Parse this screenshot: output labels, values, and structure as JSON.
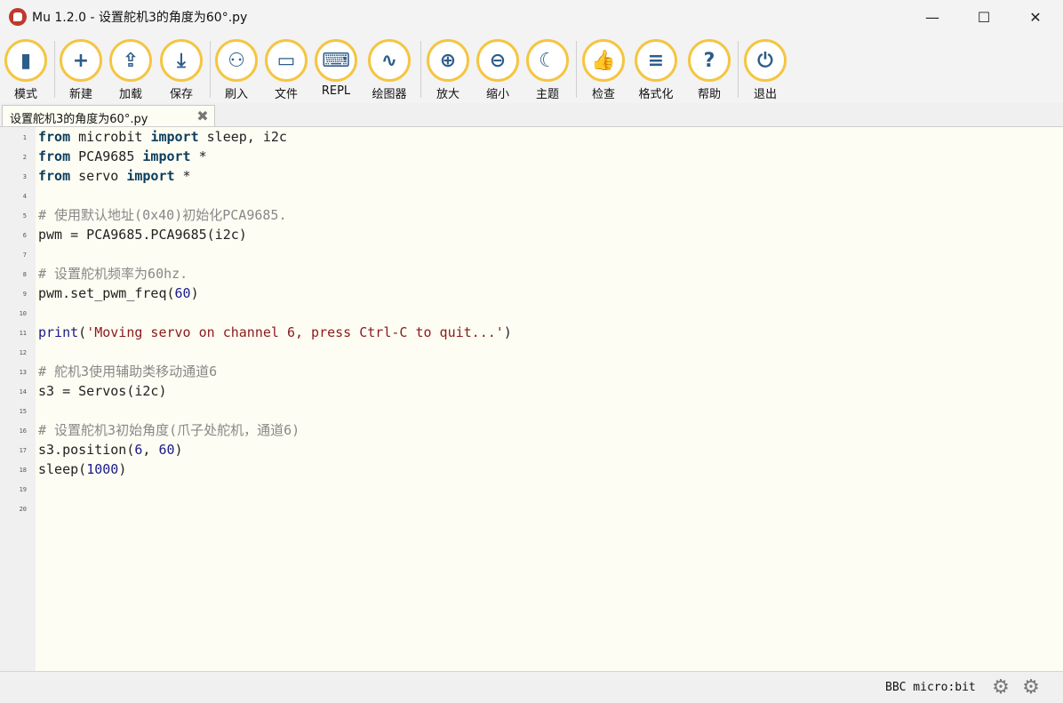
{
  "window": {
    "title": "Mu 1.2.0 - 设置舵机3的角度为60°.py",
    "minimize": "—",
    "maximize": "☐",
    "close": "✕"
  },
  "toolbar": {
    "buttons": [
      {
        "label": "模式",
        "icon": "mode-icon",
        "glyph": "▮"
      },
      {
        "label": "新建",
        "icon": "plus-icon",
        "glyph": "+"
      },
      {
        "label": "加载",
        "icon": "upload-icon",
        "glyph": "⇪"
      },
      {
        "label": "保存",
        "icon": "download-icon",
        "glyph": "⤓"
      },
      {
        "label": "刷入",
        "icon": "microbit-icon",
        "glyph": "⚇"
      },
      {
        "label": "文件",
        "icon": "files-icon",
        "glyph": "▭"
      },
      {
        "label": "REPL",
        "icon": "keyboard-icon",
        "glyph": "⌨"
      },
      {
        "label": "绘图器",
        "icon": "plotter-icon",
        "glyph": "∿"
      },
      {
        "label": "放大",
        "icon": "zoom-in-icon",
        "glyph": "⊕"
      },
      {
        "label": "缩小",
        "icon": "zoom-out-icon",
        "glyph": "⊖"
      },
      {
        "label": "主题",
        "icon": "moon-icon",
        "glyph": "☾"
      },
      {
        "label": "检查",
        "icon": "thumbs-up-icon",
        "glyph": "👍"
      },
      {
        "label": "格式化",
        "icon": "format-icon",
        "glyph": "≡"
      },
      {
        "label": "帮助",
        "icon": "help-icon",
        "glyph": "?"
      },
      {
        "label": "退出",
        "icon": "power-icon",
        "glyph": "⏻"
      }
    ]
  },
  "tab": {
    "label": "设置舵机3的角度为60°.py",
    "close": "✖"
  },
  "editor": {
    "line_numbers": [
      "1",
      "2",
      "3",
      "4",
      "5",
      "6",
      "7",
      "8",
      "9",
      "10",
      "11",
      "12",
      "13",
      "14",
      "15",
      "16",
      "17",
      "18",
      "19",
      "20"
    ]
  },
  "status": {
    "mode": "BBC micro:bit"
  },
  "colors": {
    "accent": "#f5c542",
    "icon": "#2d5d8a",
    "editor_bg": "#fdfdf3"
  }
}
